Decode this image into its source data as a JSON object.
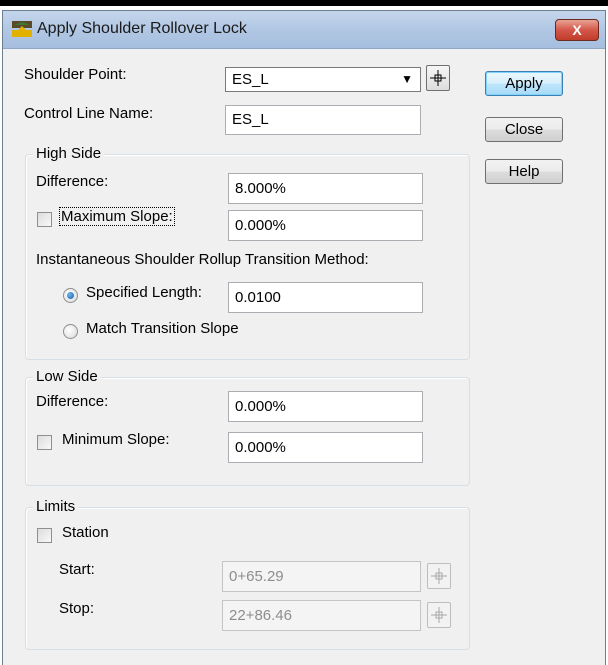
{
  "window": {
    "title": "Apply Shoulder Rollover Lock",
    "close_glyph": "X"
  },
  "shoulder_point": {
    "label": "Shoulder Point:",
    "value": "ES_L"
  },
  "control_line": {
    "label": "Control Line Name:",
    "value": "ES_L"
  },
  "buttons": {
    "apply": "Apply",
    "close": "Close",
    "help": "Help"
  },
  "high_side": {
    "title": "High Side",
    "difference_label": "Difference:",
    "difference_value": "8.000%",
    "max_slope_label": "Maximum Slope:",
    "max_slope_checked": false,
    "max_slope_value": "0.000%",
    "method_label": "Instantaneous Shoulder Rollup Transition Method:",
    "specified_length_label": "Specified Length:",
    "specified_length_value": "0.0100",
    "specified_length_selected": true,
    "match_slope_label": "Match Transition Slope",
    "match_slope_selected": false
  },
  "low_side": {
    "title": "Low Side",
    "difference_label": "Difference:",
    "difference_value": "0.000%",
    "min_slope_label": "Minimum Slope:",
    "min_slope_checked": false,
    "min_slope_value": "0.000%"
  },
  "limits": {
    "title": "Limits",
    "station_label": "Station",
    "station_checked": false,
    "start_label": "Start:",
    "start_value": "0+65.29",
    "stop_label": "Stop:",
    "stop_value": "22+86.46"
  },
  "icons": {
    "app": "road-cross-section-icon",
    "pick": "crosshair-pick-icon",
    "dropdown": "chevron-down-icon"
  }
}
